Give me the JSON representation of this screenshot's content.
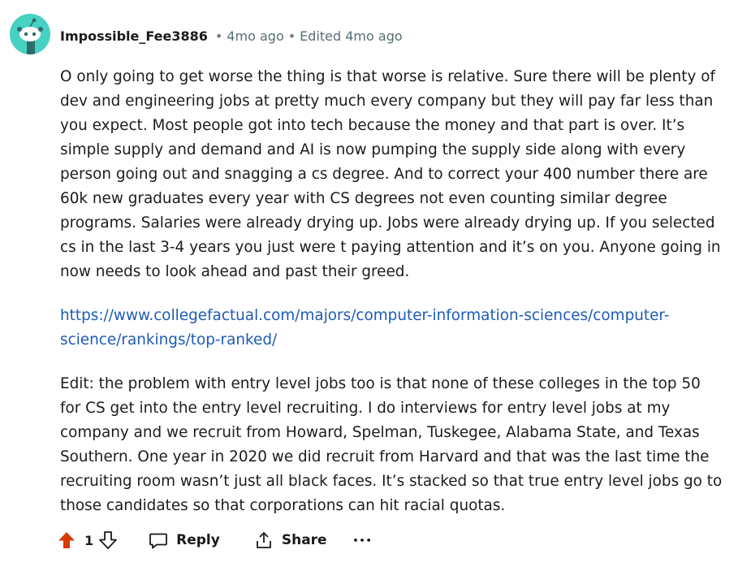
{
  "comment": {
    "username": "Impossible_Fee3886",
    "time": "4mo ago",
    "edited": "Edited 4mo ago",
    "paragraphs": [
      "O only going to get worse the thing is that worse is relative. Sure there will be plenty of dev and engineering jobs at pretty much every company but they will pay far less than you expect. Most people got into tech because the money and that part is over. It’s simple supply and demand and AI is now pumping the supply side along with every person going out and snagging a cs degree. And to correct your 400 number there are 60k new graduates every year with CS degrees not even counting similar degree programs. Salaries were already drying up. Jobs were already drying up. If you selected cs in the last 3-4 years you just were t paying attention and it’s on you. Anyone going in now needs to look ahead and past their greed.",
      "https://www.collegefactual.com/majors/computer-information-sciences/computer-science/rankings/top-ranked/",
      "Edit: the problem with entry level jobs too is that none of these colleges in the top 50 for CS get into the entry level recruiting. I do interviews for entry level jobs at my company and we recruit from Howard, Spelman, Tuskegee, Alabama State, and Texas Southern. One year in 2020 we did recruit from Harvard and that was the last time the recruiting room wasn’t just all black faces. It’s stacked so that true entry level jobs go to those candidates so that corporations can hit racial quotas."
    ]
  },
  "actions": {
    "vote_count": "1",
    "reply_label": "Reply",
    "share_label": "Share",
    "more_label": "•••"
  },
  "colors": {
    "upvote_active": "#d93a00",
    "link": "#1e5bb5",
    "avatar_bg": "#46d1c2"
  }
}
